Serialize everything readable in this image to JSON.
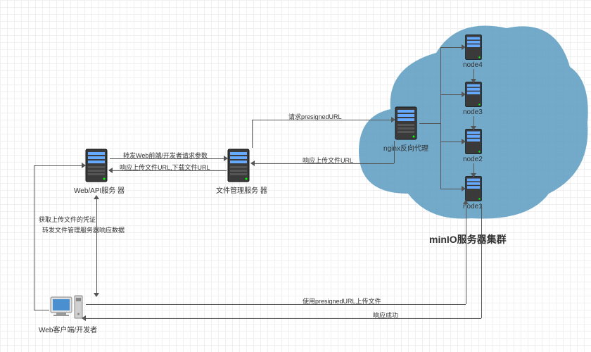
{
  "cluster_title": "minIO服务器集群",
  "nodes": {
    "web_api_server": {
      "label": "Web/API服务\n器"
    },
    "file_server": {
      "label": "文件管理服务\n器"
    },
    "nginx": {
      "label": "nginx反向代理"
    },
    "node4": {
      "label": "node4"
    },
    "node3": {
      "label": "node3"
    },
    "node2": {
      "label": "node2"
    },
    "node1": {
      "label": "node1"
    },
    "client": {
      "label": "Web客户端/开发者"
    }
  },
  "edges": {
    "e1": {
      "label": "转发Web前端/开发者请求参数"
    },
    "e2": {
      "label": "响应上传文件URL,下载文件URL"
    },
    "e3": {
      "label": "请求presignedURL"
    },
    "e4": {
      "label": "响应上传文件URL"
    },
    "e5": {
      "label": "获取上传文件的凭证"
    },
    "e6": {
      "label": "转发文件管理服务器响应数据"
    },
    "e7": {
      "label": "使用presignedURL上传文件"
    },
    "e8": {
      "label": "响应成功"
    }
  }
}
